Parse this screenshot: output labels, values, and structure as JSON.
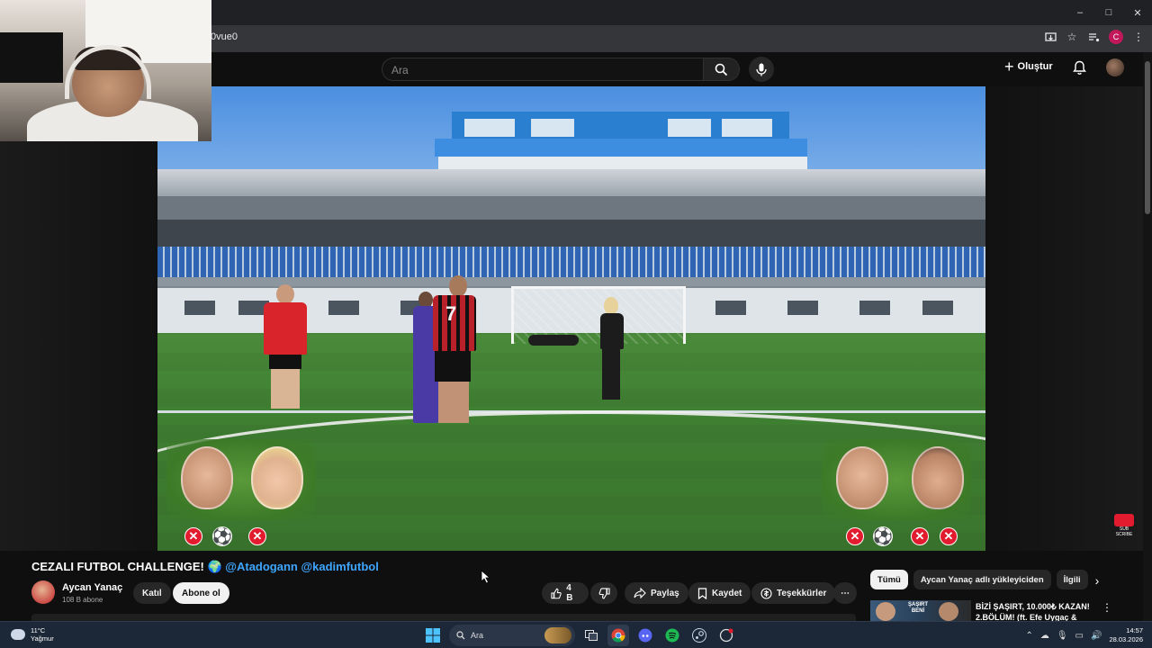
{
  "browser": {
    "url_fragment": "0vue0",
    "window_controls": [
      "–",
      "□",
      "✕"
    ]
  },
  "header": {
    "search_placeholder": "Ara",
    "create_label": "Oluştur"
  },
  "video": {
    "title_main": "CEZALI FUTBOL CHALLENGE!",
    "title_emoji": "🌍",
    "mention_1": "@Atadogann",
    "mention_2": "@kadimfutbol",
    "player_number": "7",
    "overlay_x": "✕",
    "overlay_ball": "⚽"
  },
  "channel": {
    "name": "Aycan Yanaç",
    "subscribers": "108 B abone",
    "join_label": "Katıl",
    "subscribe_label": "Abone ol"
  },
  "actions": {
    "likes": "4 B",
    "share_label": "Paylaş",
    "save_label": "Kaydet",
    "thanks_label": "Teşekkürler",
    "more_label": "⋯"
  },
  "chips": {
    "all": "Tümü",
    "from_channel": "Aycan Yanaç adlı yükleyiciden",
    "related": "İlgili"
  },
  "recommendation": {
    "title": "BİZİ ŞAŞIRT, 10.000₺ KAZAN! 2.BÖLÜM! (ft. Efe Uygaç &",
    "thumb_text": "ŞAŞIRT BENİ"
  },
  "subscribe_badge": {
    "text_line1": "SUB",
    "text_line2": "SCRIBE"
  },
  "taskbar": {
    "temperature": "11°C",
    "weather": "Yağmur",
    "search_label": "Ara",
    "time": "14:57",
    "date": "28.03.2026"
  }
}
